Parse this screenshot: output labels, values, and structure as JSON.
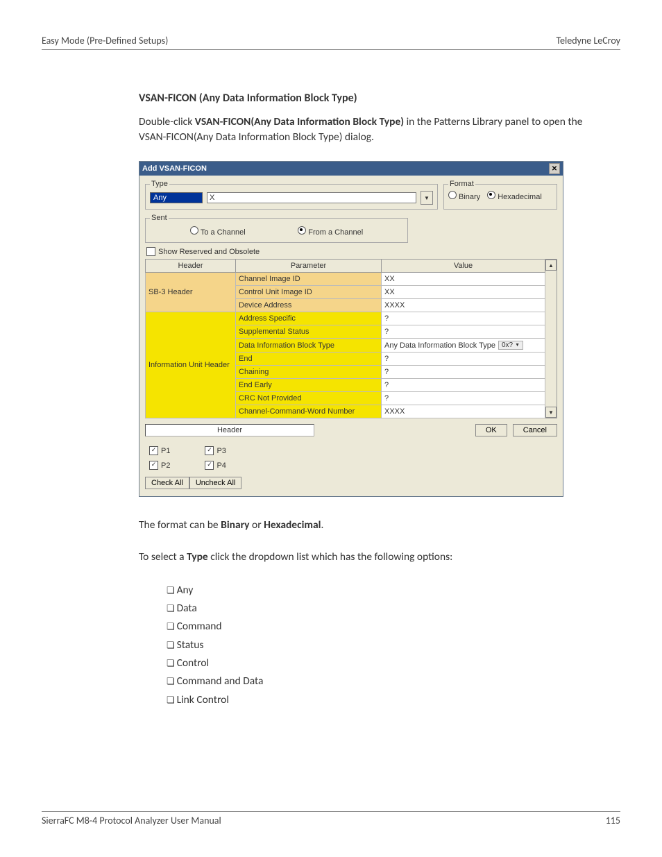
{
  "header": {
    "left": "Easy Mode (Pre-Defined Setups)",
    "right": "Teledyne  LeCroy"
  },
  "section_title": "VSAN-FICON (Any Data Information Block Type)",
  "intro": {
    "pre": "Double-click ",
    "bold": "VSAN-FICON(Any Data Information Block Type)",
    "post": " in the Patterns Library panel to open the VSAN-FICON(Any Data Information Block Type) dialog."
  },
  "dialog": {
    "title": "Add VSAN-FICON",
    "type": {
      "legend": "Type",
      "selected": "Any",
      "text_value": "X"
    },
    "format": {
      "legend": "Format",
      "binary": "Binary",
      "hex": "Hexadecimal",
      "selected": "hex"
    },
    "sent": {
      "legend": "Sent",
      "to": "To a Channel",
      "from": "From a Channel",
      "selected": "from"
    },
    "show_reserved": {
      "label": "Show Reserved and Obsolete",
      "checked": false
    },
    "table": {
      "cols": [
        "Header",
        "Parameter",
        "Value"
      ],
      "groups": [
        {
          "header": "SB-3 Header",
          "style": "orange",
          "rows": [
            {
              "param": "Channel Image ID",
              "value": "XX"
            },
            {
              "param": "Control Unit Image ID",
              "value": "XX"
            },
            {
              "param": "Device Address",
              "value": "XXXX"
            }
          ]
        },
        {
          "header": "Information Unit Header",
          "style": "yellow",
          "rows": [
            {
              "param": "Address Specific",
              "value": "?"
            },
            {
              "param": "Supplemental Status",
              "value": "?"
            },
            {
              "param": "Data Information Block Type",
              "value": "Any Data Information Block Type",
              "dd": "0x?"
            },
            {
              "param": "End",
              "value": "?"
            },
            {
              "param": "Chaining",
              "value": "?"
            },
            {
              "param": "End Early",
              "value": "?"
            },
            {
              "param": "CRC Not Provided",
              "value": "?"
            },
            {
              "param": "Channel-Command-Word Number",
              "value": "XXXX"
            }
          ]
        }
      ]
    },
    "header_label": "Header",
    "ok": "OK",
    "cancel": "Cancel",
    "ports": {
      "p1": "P1",
      "p2": "P2",
      "p3": "P3",
      "p4": "P4"
    },
    "check_all": "Check All",
    "uncheck_all": "Uncheck All"
  },
  "after1": {
    "pre": "The format can be ",
    "b1": "Binary",
    "mid": " or ",
    "b2": "Hexadecimal",
    "post": "."
  },
  "after2": {
    "pre": "To select a ",
    "b": "Type",
    "post": " click the dropdown list which has the following options:"
  },
  "options": [
    "Any",
    "Data",
    "Command",
    "Status",
    "Control",
    "Command and Data",
    "Link Control"
  ],
  "footer": {
    "left": "SierraFC M8-4 Protocol Analyzer User Manual",
    "right": "115"
  }
}
